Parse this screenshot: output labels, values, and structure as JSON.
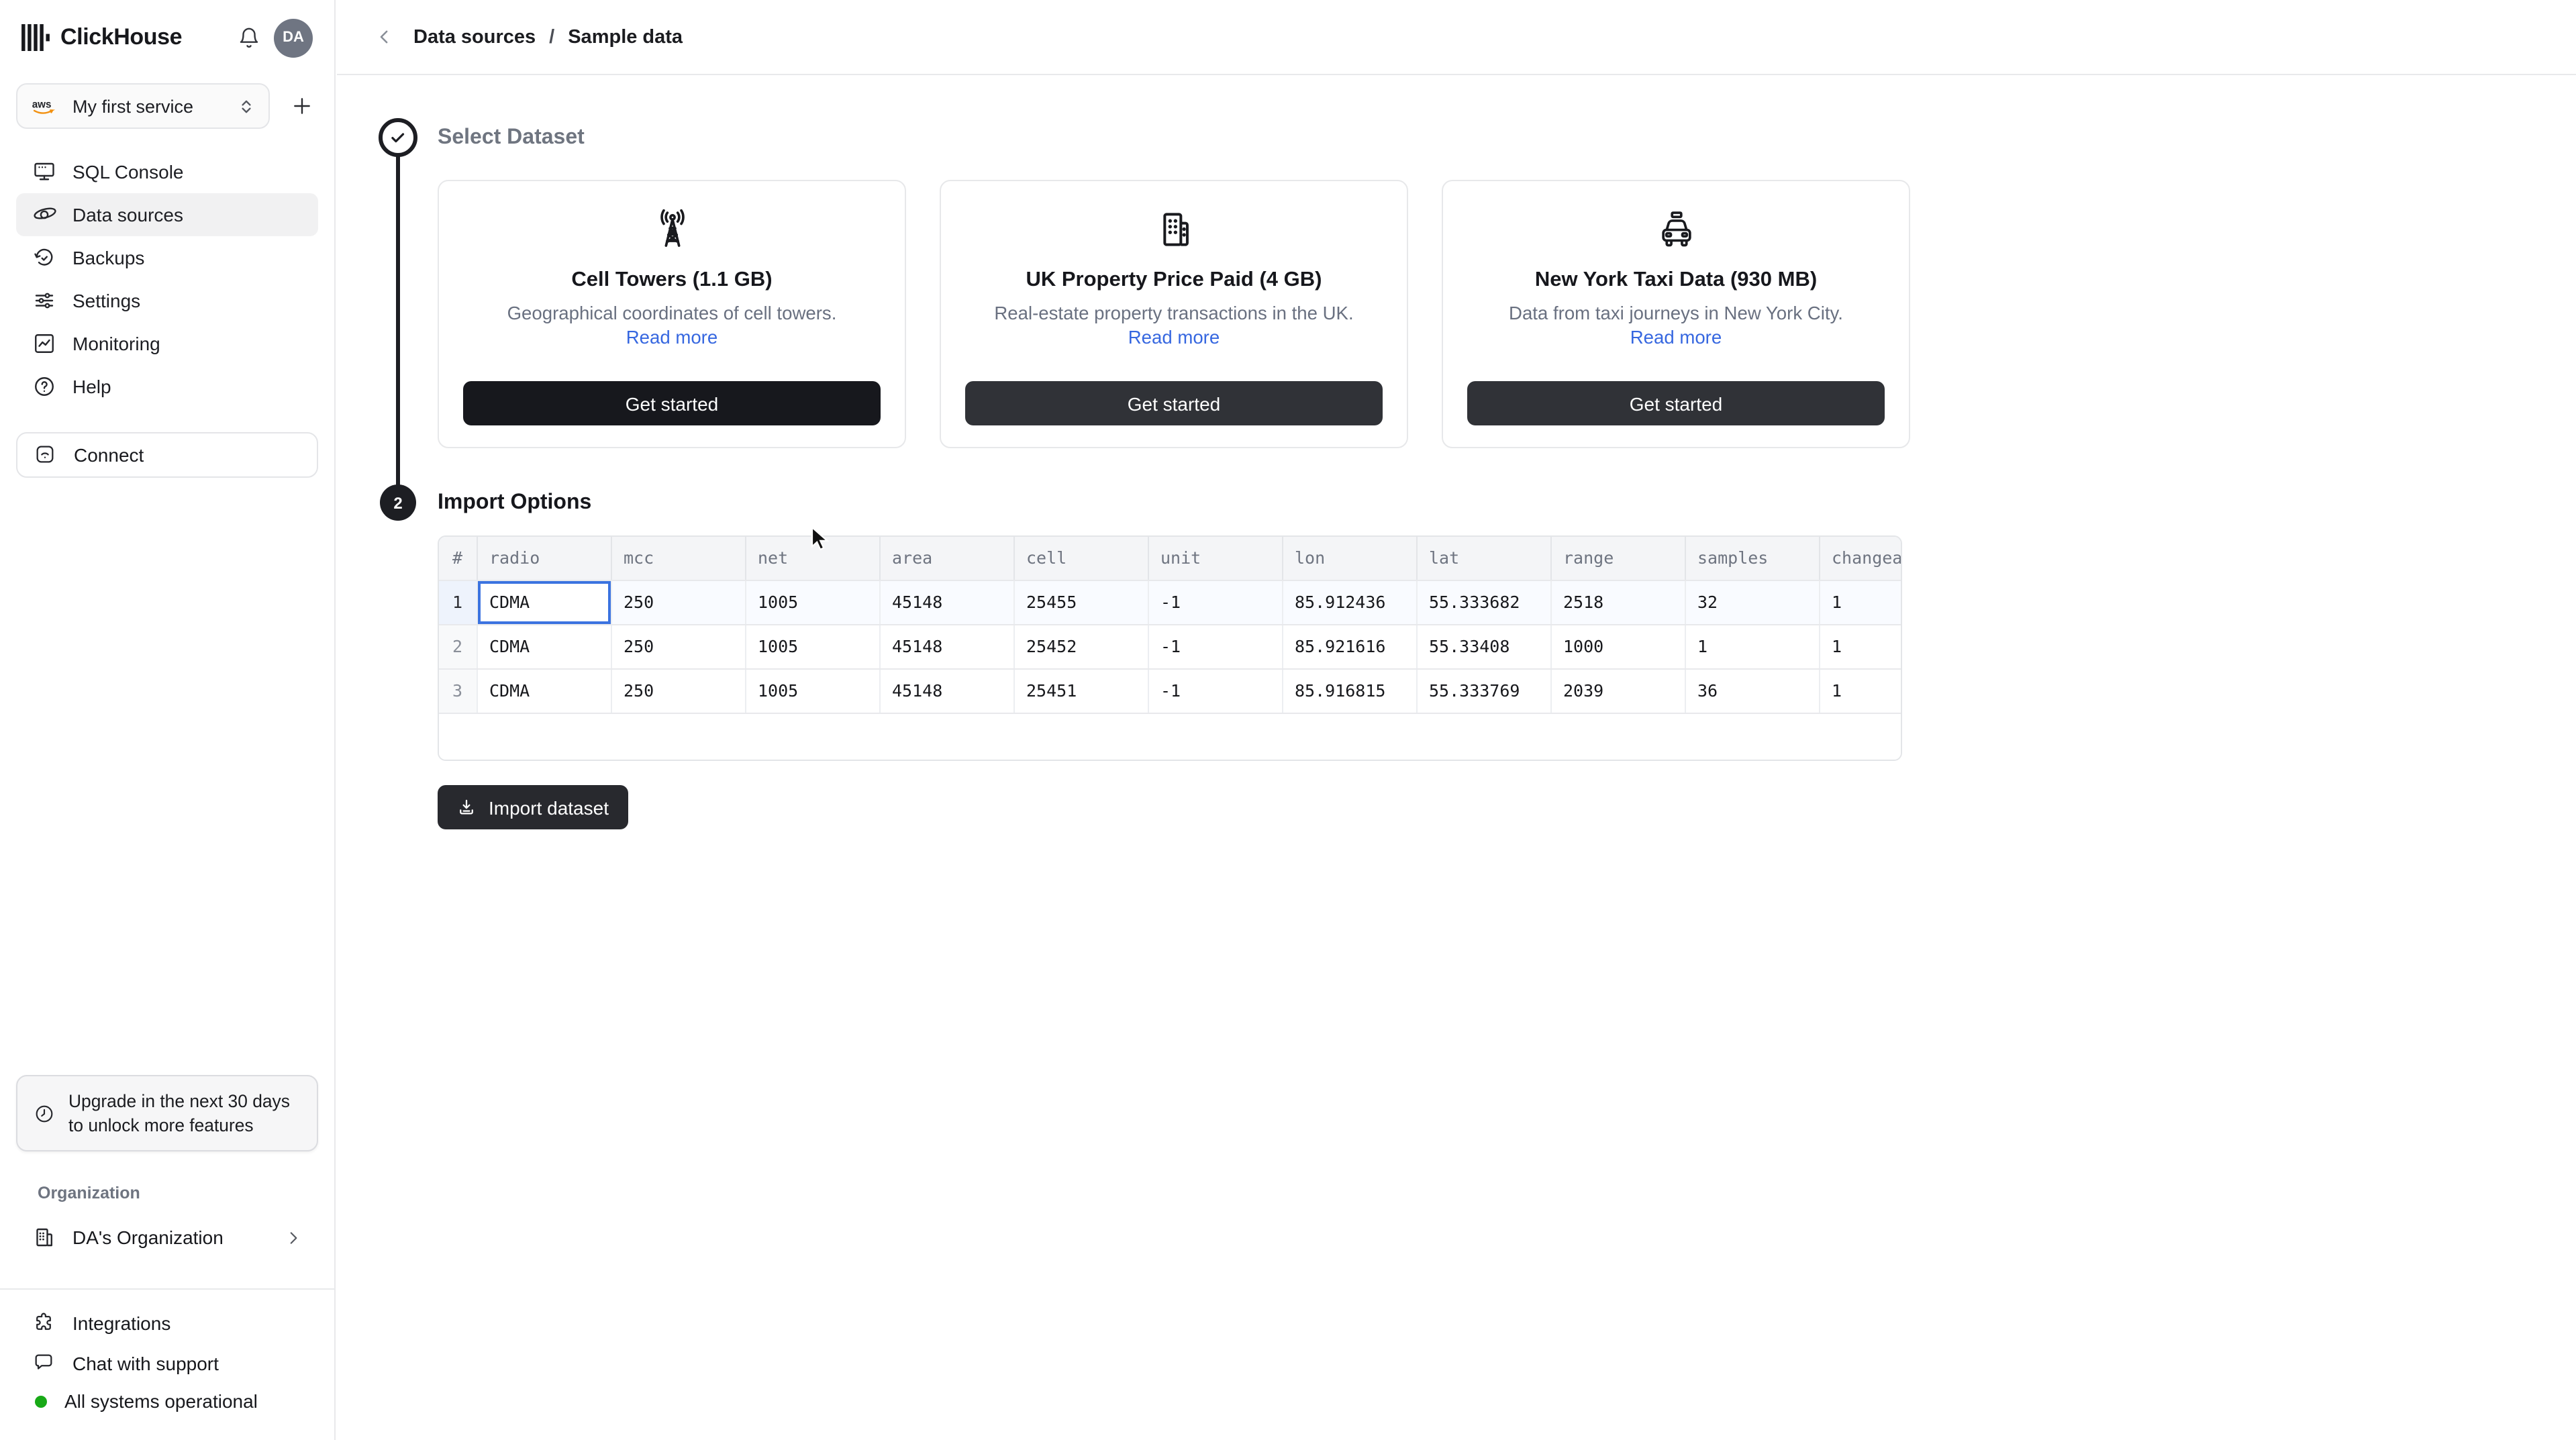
{
  "header": {
    "logo_text": "ClickHouse",
    "avatar_initials": "DA"
  },
  "service_selector": {
    "provider_label": "aws",
    "service_name": "My first service"
  },
  "sidebar": {
    "nav_items": [
      {
        "label": "SQL Console"
      },
      {
        "label": "Data sources"
      },
      {
        "label": "Backups"
      },
      {
        "label": "Settings"
      },
      {
        "label": "Monitoring"
      },
      {
        "label": "Help"
      }
    ],
    "connect_label": "Connect",
    "upgrade_notice": "Upgrade in the next 30 days to unlock more features",
    "organization_label": "Organization",
    "organization_name": "DA's Organization",
    "footer_items": [
      {
        "label": "Integrations"
      },
      {
        "label": "Chat with support"
      }
    ],
    "status_text": "All systems operational"
  },
  "breadcrumb": {
    "section": "Data sources",
    "separator": "/",
    "page": "Sample data"
  },
  "steps": {
    "step1_title": "Select Dataset",
    "step2_number": "2",
    "step2_title": "Import Options"
  },
  "datasets": [
    {
      "title": "Cell Towers (1.1 GB)",
      "description": "Geographical coordinates of cell towers.",
      "link": "Read more",
      "cta": "Get started"
    },
    {
      "title": "UK Property Price Paid (4 GB)",
      "description": "Real-estate property transactions in the UK.",
      "link": "Read more",
      "cta": "Get started"
    },
    {
      "title": "New York Taxi Data (930 MB)",
      "description": "Data from taxi journeys in New York City.",
      "link": "Read more",
      "cta": "Get started"
    }
  ],
  "table": {
    "columns": [
      "#",
      "radio",
      "mcc",
      "net",
      "area",
      "cell",
      "unit",
      "lon",
      "lat",
      "range",
      "samples",
      "changeable"
    ],
    "rows": [
      [
        "1",
        "CDMA",
        "250",
        "1005",
        "45148",
        "25455",
        "-1",
        "85.912436",
        "55.333682",
        "2518",
        "32",
        "1"
      ],
      [
        "2",
        "CDMA",
        "250",
        "1005",
        "45148",
        "25452",
        "-1",
        "85.921616",
        "55.33408",
        "1000",
        "1",
        "1"
      ],
      [
        "3",
        "CDMA",
        "250",
        "1005",
        "45148",
        "25451",
        "-1",
        "85.916815",
        "55.333769",
        "2039",
        "36",
        "1"
      ]
    ],
    "selected_cell": {
      "row": "1",
      "column": "radio"
    }
  },
  "import_button_label": "Import dataset",
  "colors": {
    "accent_blue": "#3667e0",
    "selected_cell_border": "#3b73e0",
    "status_green": "#18a917",
    "step_dark": "#1d1e23",
    "cta_primary_dark": "#17181d",
    "cta_secondary_dark": "#303237"
  }
}
